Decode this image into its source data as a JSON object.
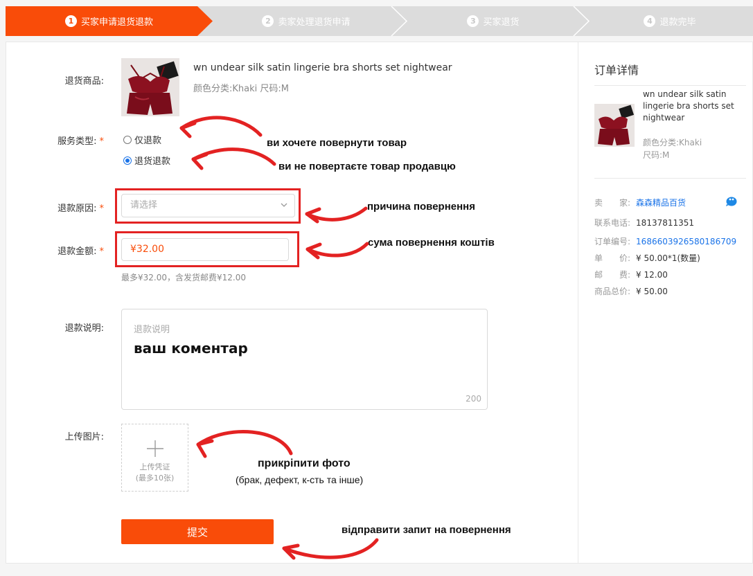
{
  "steps": [
    {
      "num": "1",
      "label": "买家申请退货退款",
      "active": true
    },
    {
      "num": "2",
      "label": "卖家处理退货申请",
      "active": false
    },
    {
      "num": "3",
      "label": "买家退货",
      "active": false
    },
    {
      "num": "4",
      "label": "退款完毕",
      "active": false
    }
  ],
  "form": {
    "product_label": "退货商品:",
    "product_title": "wn undear silk satin lingerie bra shorts set nightwear",
    "product_sku": "颜色分类:Khaki   尺码:M",
    "service_label": "服务类型:",
    "service_options": [
      {
        "label": "仅退款",
        "checked": false
      },
      {
        "label": "退货退款",
        "checked": true
      }
    ],
    "reason_label": "退款原因:",
    "reason_placeholder": "请选择",
    "amount_label": "退款金额:",
    "amount_value": "¥32.00",
    "amount_hint": "最多¥32.00，含发货邮费¥12.00",
    "note_label": "退款说明:",
    "note_placeholder": "退款说明",
    "note_count": "200",
    "upload_label": "上传图片:",
    "upload_text1": "上传凭证",
    "upload_text2": "(最多10张)",
    "submit_label": "提交",
    "required_mark": "*"
  },
  "annotations": {
    "refund_only": "ви хочете повернути товар",
    "return_refund": "ви не повертаєте товар продавцю",
    "reason": "причина повернення",
    "amount": "сума повернення коштів",
    "comment": "ваш коментар",
    "photo": "прикріпити фото",
    "photo_sub": "(брак, дефект, к-сть та інше)",
    "submit": "відправити запит на повернення"
  },
  "sidebar": {
    "title": "订单详情",
    "product_title": "wn undear silk satin lingerie bra shorts set nightwear",
    "sku_color": "颜色分类:Khaki",
    "sku_size": "尺码:M",
    "seller_label": "卖　　家:",
    "seller_value": "森森精品百货",
    "phone_label": "联系电话:",
    "phone_value": "18137811351",
    "order_label": "订单编号:",
    "order_value": "1686603926580186709",
    "price_label": "单　　价:",
    "price_value": "¥ 50.00*1(数量)",
    "postage_label": "邮　　费:",
    "postage_value": "¥ 12.00",
    "total_label": "商品总价:",
    "total_value": "¥ 50.00"
  },
  "colors": {
    "accent": "#f94c09",
    "annotation_red": "#e32222",
    "link_blue": "#1a73e8",
    "step_inactive": "#dcdcdc"
  },
  "icons": [
    "chevron-down-icon",
    "plus-icon",
    "wangwang-chat-icon"
  ]
}
